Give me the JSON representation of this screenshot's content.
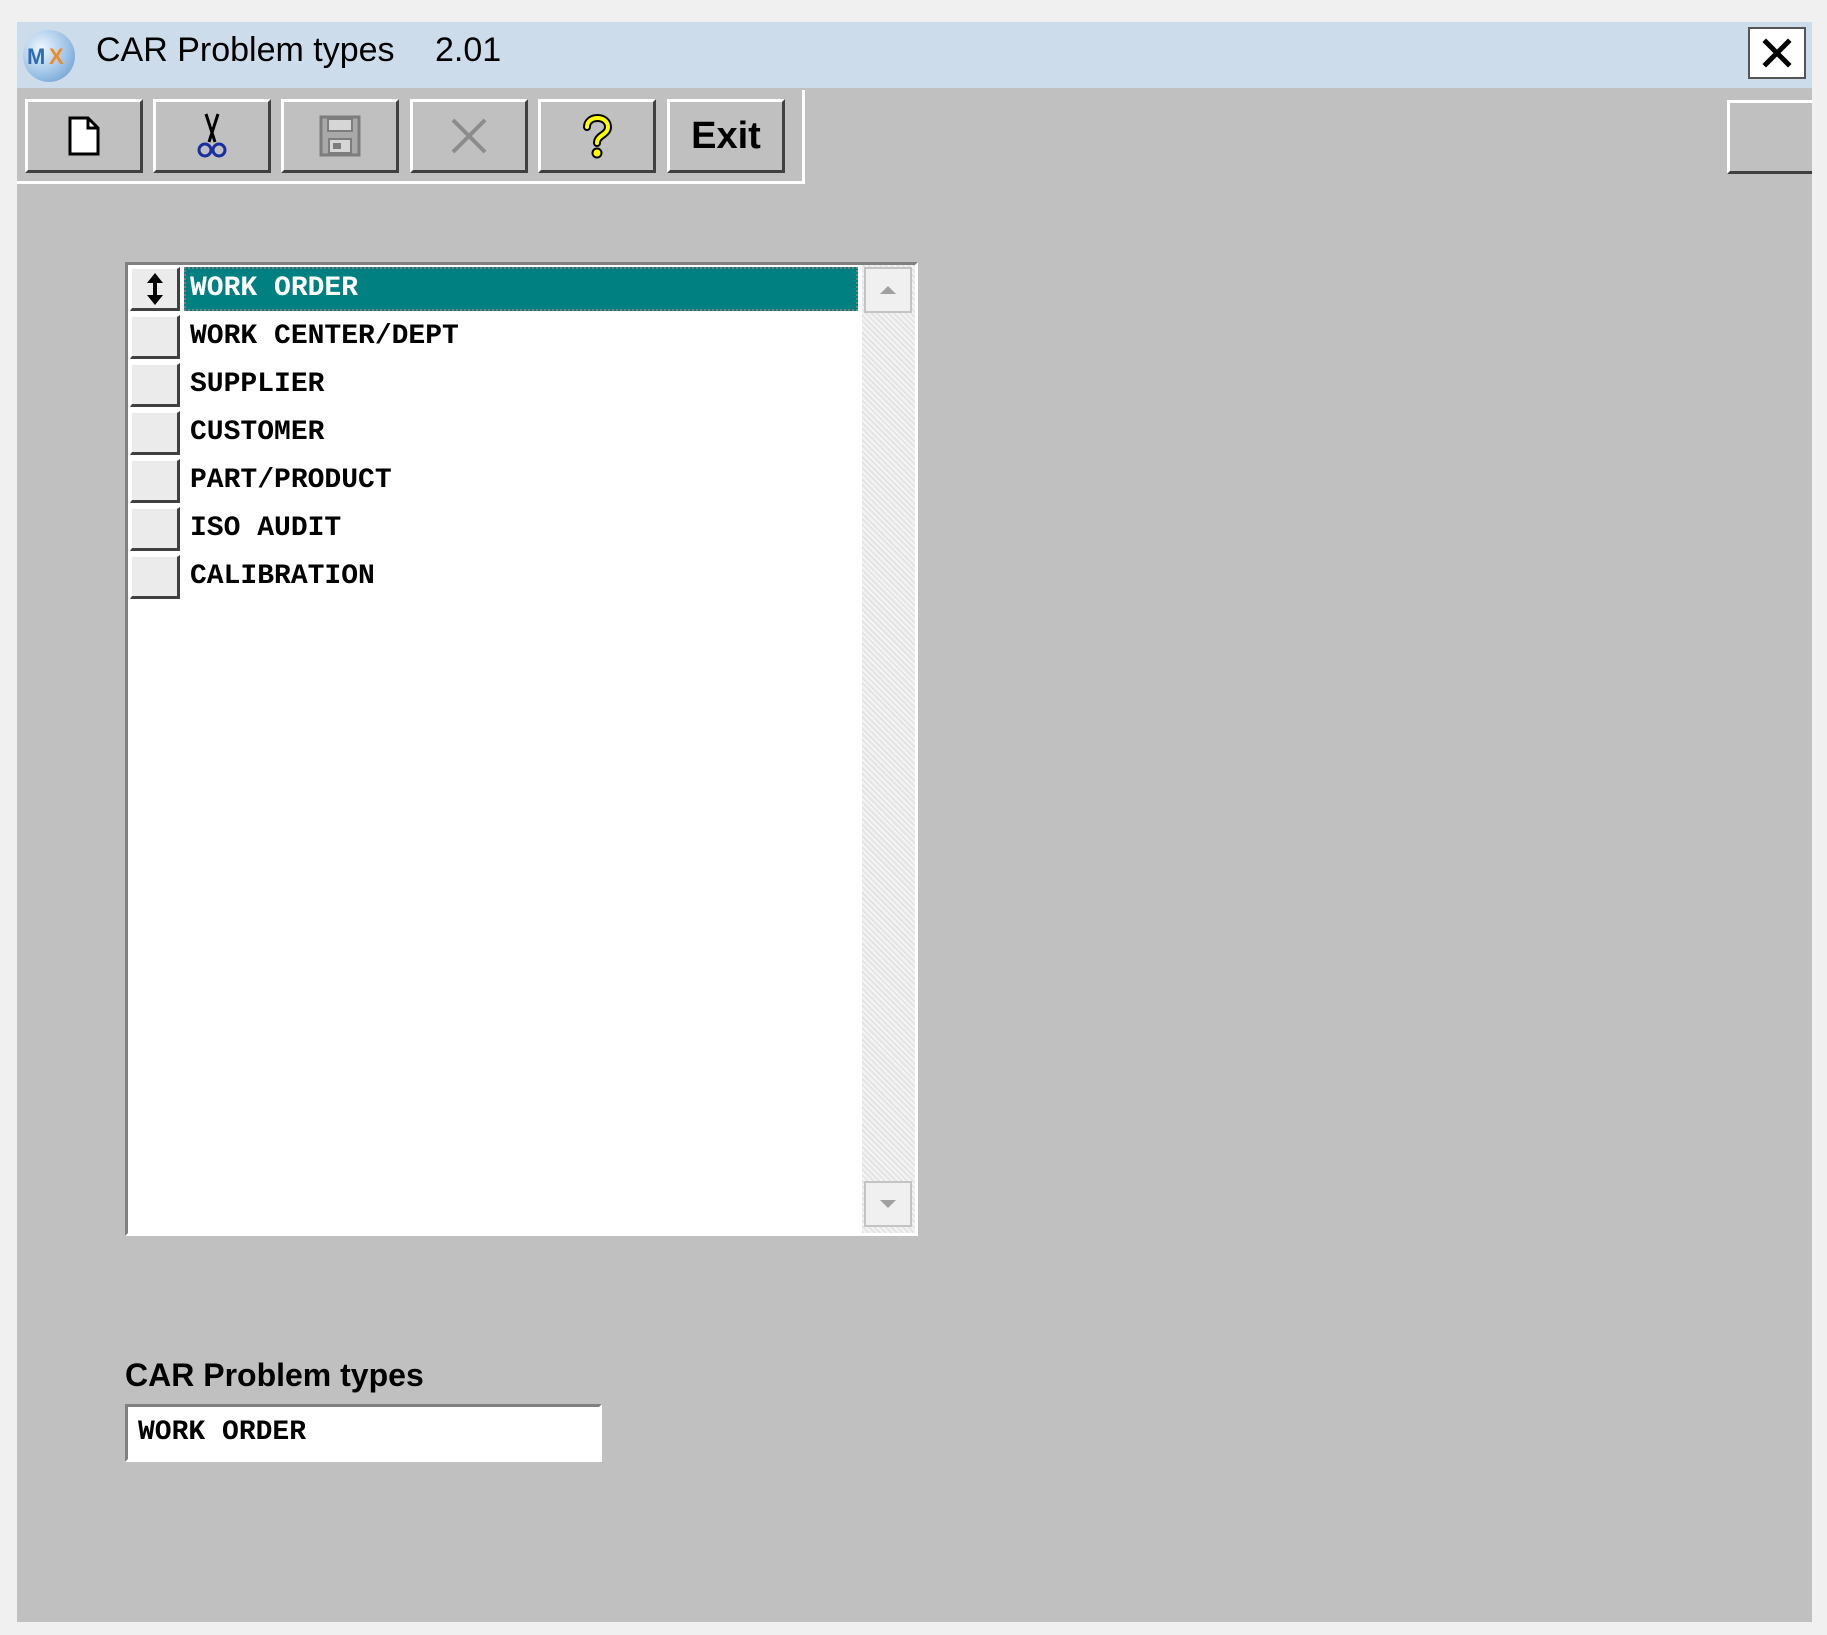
{
  "window": {
    "title": "CAR Problem types",
    "version": "2.01",
    "close_icon": "close-icon"
  },
  "toolbar": {
    "buttons": [
      {
        "name": "new",
        "icon": "new-document-icon"
      },
      {
        "name": "cut",
        "icon": "scissors-icon"
      },
      {
        "name": "save",
        "icon": "save-icon",
        "disabled": true
      },
      {
        "name": "delete",
        "icon": "delete-x-icon",
        "disabled": true
      },
      {
        "name": "help",
        "icon": "help-icon"
      },
      {
        "name": "exit",
        "label": "Exit"
      }
    ]
  },
  "list": {
    "items": [
      "WORK ORDER",
      "WORK CENTER/DEPT",
      "SUPPLIER",
      "CUSTOMER",
      "PART/PRODUCT",
      "ISO AUDIT",
      "CALIBRATION"
    ],
    "selected_index": 0,
    "selected_color": "#008080"
  },
  "field": {
    "label": "CAR Problem types",
    "value": "WORK ORDER"
  }
}
